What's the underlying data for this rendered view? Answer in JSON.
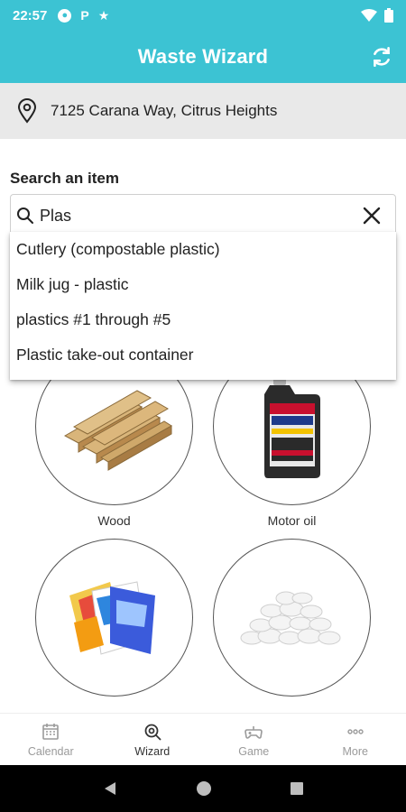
{
  "status_bar": {
    "time": "22:57",
    "icons": [
      "account-circle-icon",
      "parking-icon",
      "star-icon"
    ],
    "right_icons": [
      "wifi-icon",
      "battery-icon"
    ]
  },
  "app_bar": {
    "title": "Waste Wizard",
    "action_icon": "refresh-icon"
  },
  "location": {
    "icon": "location-pin-icon",
    "address": "7125 Carana Way, Citrus Heights"
  },
  "search": {
    "label": "Search an item",
    "value": "Plas",
    "suggestions": [
      "Cutlery (compostable plastic)",
      "Milk jug - plastic",
      "plastics #1 through #5",
      "Plastic take-out container"
    ]
  },
  "items": [
    {
      "label": "Wood",
      "image": "wood-planks-image"
    },
    {
      "label": "Motor oil",
      "image": "motor-oil-bottle-image"
    },
    {
      "label": "",
      "image": "snack-wrappers-image"
    },
    {
      "label": "",
      "image": "packing-peanuts-image"
    }
  ],
  "bottom_nav": [
    {
      "label": "Calendar",
      "icon": "calendar-icon",
      "active": false
    },
    {
      "label": "Wizard",
      "icon": "wizard-icon",
      "active": true
    },
    {
      "label": "Game",
      "icon": "game-controller-icon",
      "active": false
    },
    {
      "label": "More",
      "icon": "more-icon",
      "active": false
    }
  ],
  "colors": {
    "accent": "#3cc3d3",
    "address_bar": "#e9e9e9",
    "nav_inactive": "#9a9a9a"
  }
}
